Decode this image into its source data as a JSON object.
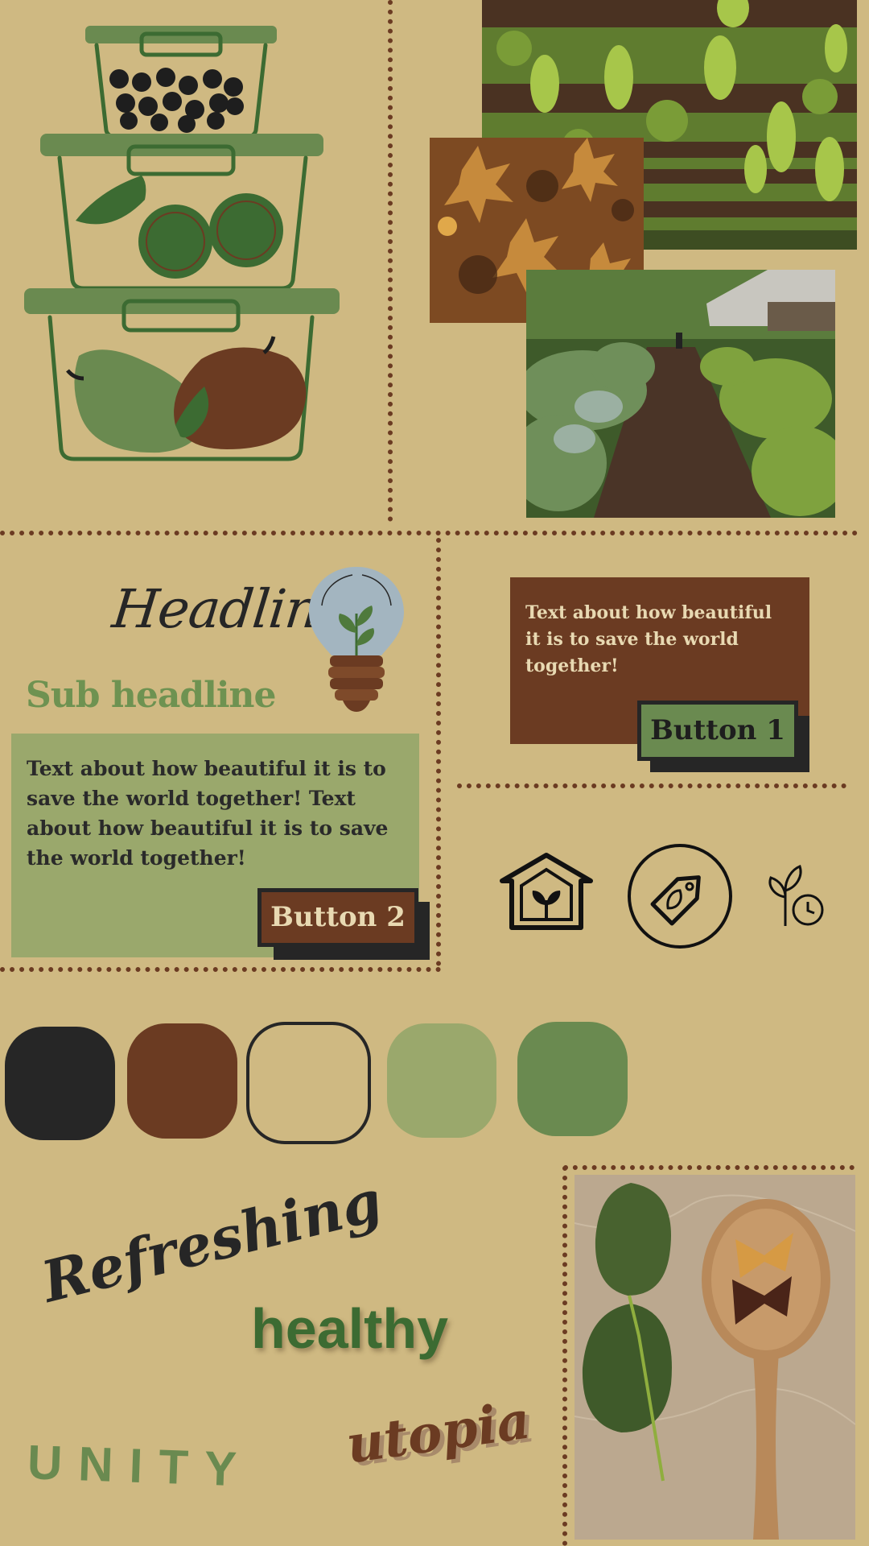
{
  "colors": {
    "background": "#cfb982",
    "dark": "#262626",
    "brown": "#6b3b22",
    "tan": "#cfb982",
    "sage": "#9aa86c",
    "green": "#6a8a50"
  },
  "left_illustration": {
    "icon": "food-containers-illustration"
  },
  "photos": [
    {
      "name": "grapevine-pergola-photo"
    },
    {
      "name": "autumn-leaves-photo"
    },
    {
      "name": "vegetable-garden-photo"
    },
    {
      "name": "spinach-spoon-photo"
    }
  ],
  "typography": {
    "headline": "Headline",
    "subheadline": "Sub headline",
    "body_long": "Text about how beautiful it is to save the world together! Text about how beautiful it is to save the world together!",
    "body_short": "Text about how beautiful it is to save the world together!"
  },
  "buttons": {
    "button1": "Button 1",
    "button2": "Button 2"
  },
  "icons": [
    "lightbulb-plant-icon",
    "house-plant-icon",
    "eco-tag-icon",
    "plant-clock-icon"
  ],
  "palette": [
    "#262626",
    "#6b3b22",
    "#cfb982",
    "#9aa86c",
    "#6a8a50"
  ],
  "words": {
    "refreshing": "Refreshing",
    "healthy": "healthy",
    "unity": "UNITY",
    "utopia": "utopia"
  }
}
